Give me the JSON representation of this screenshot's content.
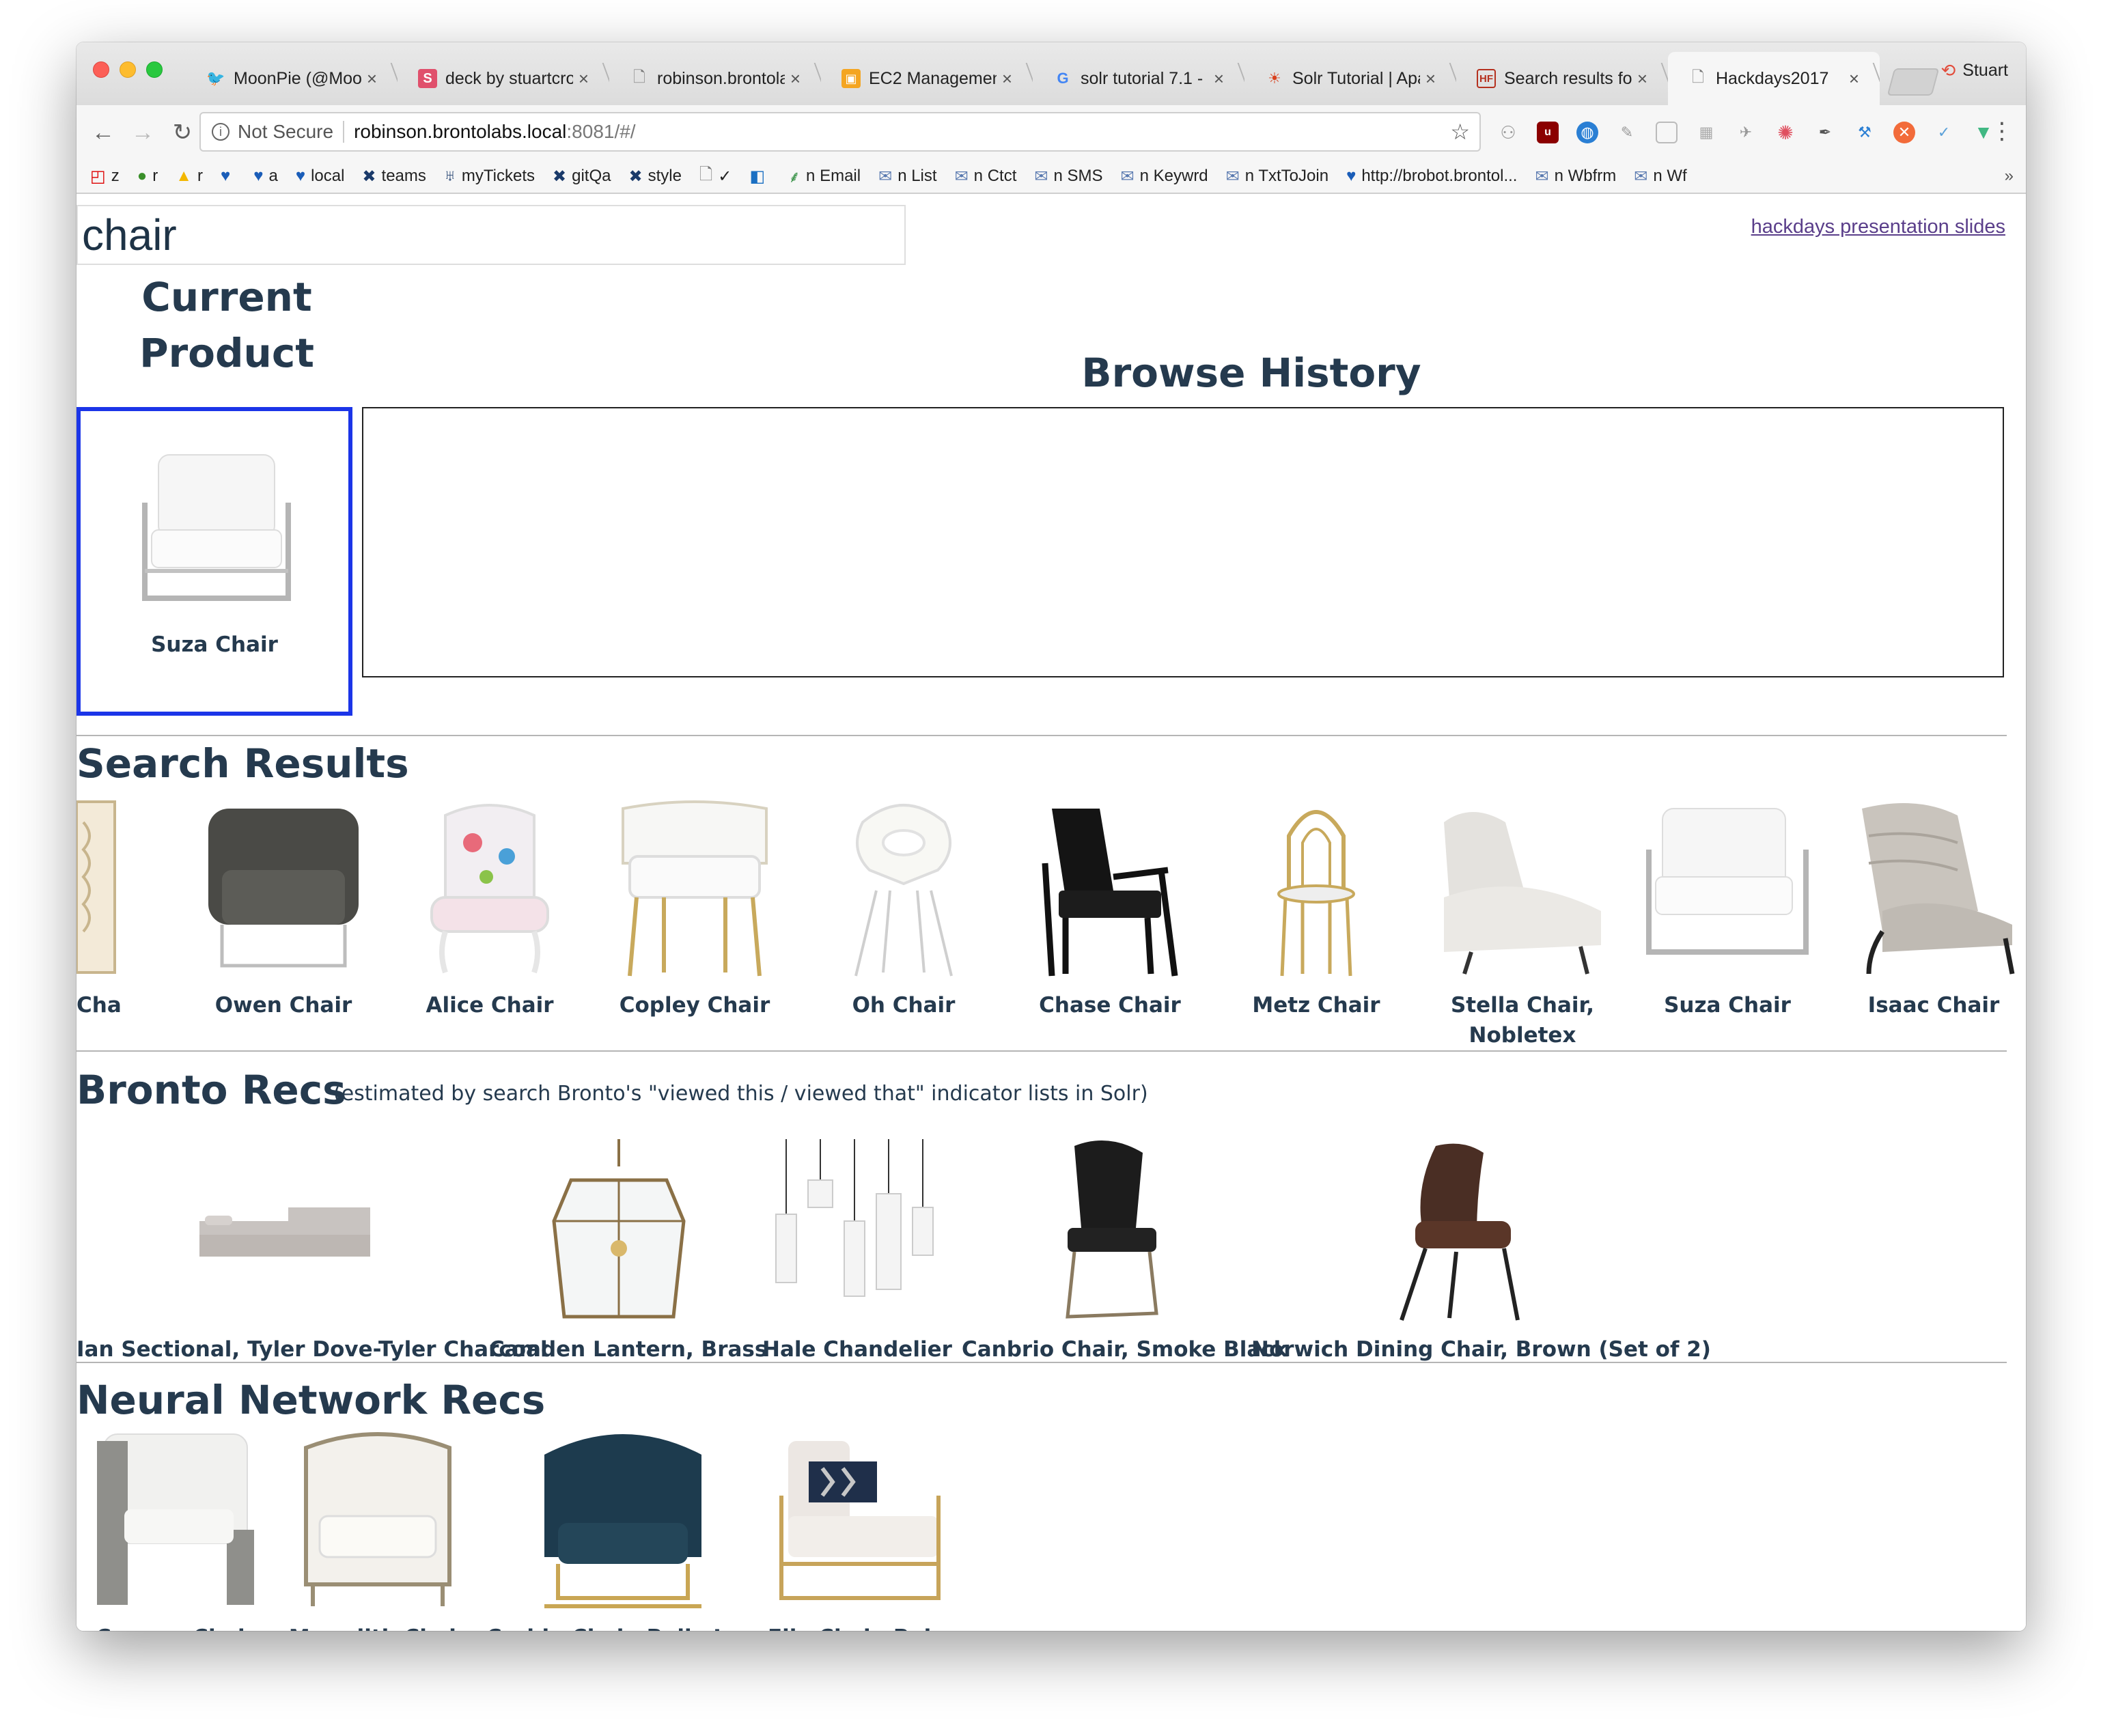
{
  "browser": {
    "tabs": [
      {
        "title": "MoonPie (@Moon",
        "icon": "twitter-icon",
        "active": false
      },
      {
        "title": "deck by stuartcro",
        "icon": "slides-icon",
        "active": false
      },
      {
        "title": "robinson.brontola",
        "icon": "page-icon",
        "active": false
      },
      {
        "title": "EC2 Management",
        "icon": "aws-icon",
        "active": false
      },
      {
        "title": "solr tutorial 7.1 - G",
        "icon": "google-icon",
        "active": false
      },
      {
        "title": "Solr Tutorial | Apa",
        "icon": "solr-icon",
        "active": false
      },
      {
        "title": "Search results for",
        "icon": "hf-icon",
        "active": false
      },
      {
        "title": "Hackdays2017",
        "icon": "page-icon",
        "active": true
      }
    ],
    "profile_name": "Stuart",
    "url": {
      "security": "Not Secure",
      "host": "robinson.brontolabs.local",
      "path": ":8081/#/"
    },
    "bookmarks": [
      "z",
      "r",
      "r",
      "",
      "a",
      "local",
      "teams",
      "myTickets",
      "gitQa",
      "style",
      "✓",
      "",
      "n Email",
      "n List",
      "n Ctct",
      "n SMS",
      "n Keywrd",
      "n TxtToJoin",
      "http://brobot.brontol...",
      "n Wbfrm",
      "n Wf"
    ],
    "bookmarks_more": "»"
  },
  "page": {
    "search_value": "chair",
    "slides_link": "hackdays presentation slides",
    "current_product_title": "Current Product",
    "browse_history_title": "Browse History",
    "current_product": {
      "name": "Suza Chair"
    },
    "search_results_title": "Search Results",
    "search_results": [
      {
        "name": "Chair"
      },
      {
        "name": "Owen Chair"
      },
      {
        "name": "Alice Chair"
      },
      {
        "name": "Copley Chair"
      },
      {
        "name": "Oh Chair"
      },
      {
        "name": "Chase Chair"
      },
      {
        "name": "Metz Chair"
      },
      {
        "name": "Stella Chair,"
      },
      {
        "name": "Suza Chair"
      },
      {
        "name": "Isaac Chair"
      }
    ],
    "search_results_extra_line": "Nobletex",
    "bronto_title": "Bronto Recs",
    "bronto_note": "(estimated by search Bronto's \"viewed this / viewed that\" indicator lists in Solr)",
    "bronto_recs": [
      {
        "name": "Ian Sectional, Tyler Dove-Tyler Charcoal"
      },
      {
        "name": "Camden Lantern, Brass"
      },
      {
        "name": "Hale Chandelier"
      },
      {
        "name": "Canbrio Chair, Smoke Black"
      },
      {
        "name": "Norwich Dining Chair, Brown (Set of 2)"
      }
    ],
    "neural_title": "Neural Network Recs",
    "neural_recs": [
      {
        "name": "Cosway Chair"
      },
      {
        "name": "Meredith Chair"
      },
      {
        "name": "Corbin Chair, Bella Jasper"
      },
      {
        "name": "Elle Chair, Beige"
      }
    ]
  },
  "colors": {
    "heading": "#253a4e",
    "current_product_border": "#1b35e8",
    "link": "#5a3e8a"
  }
}
